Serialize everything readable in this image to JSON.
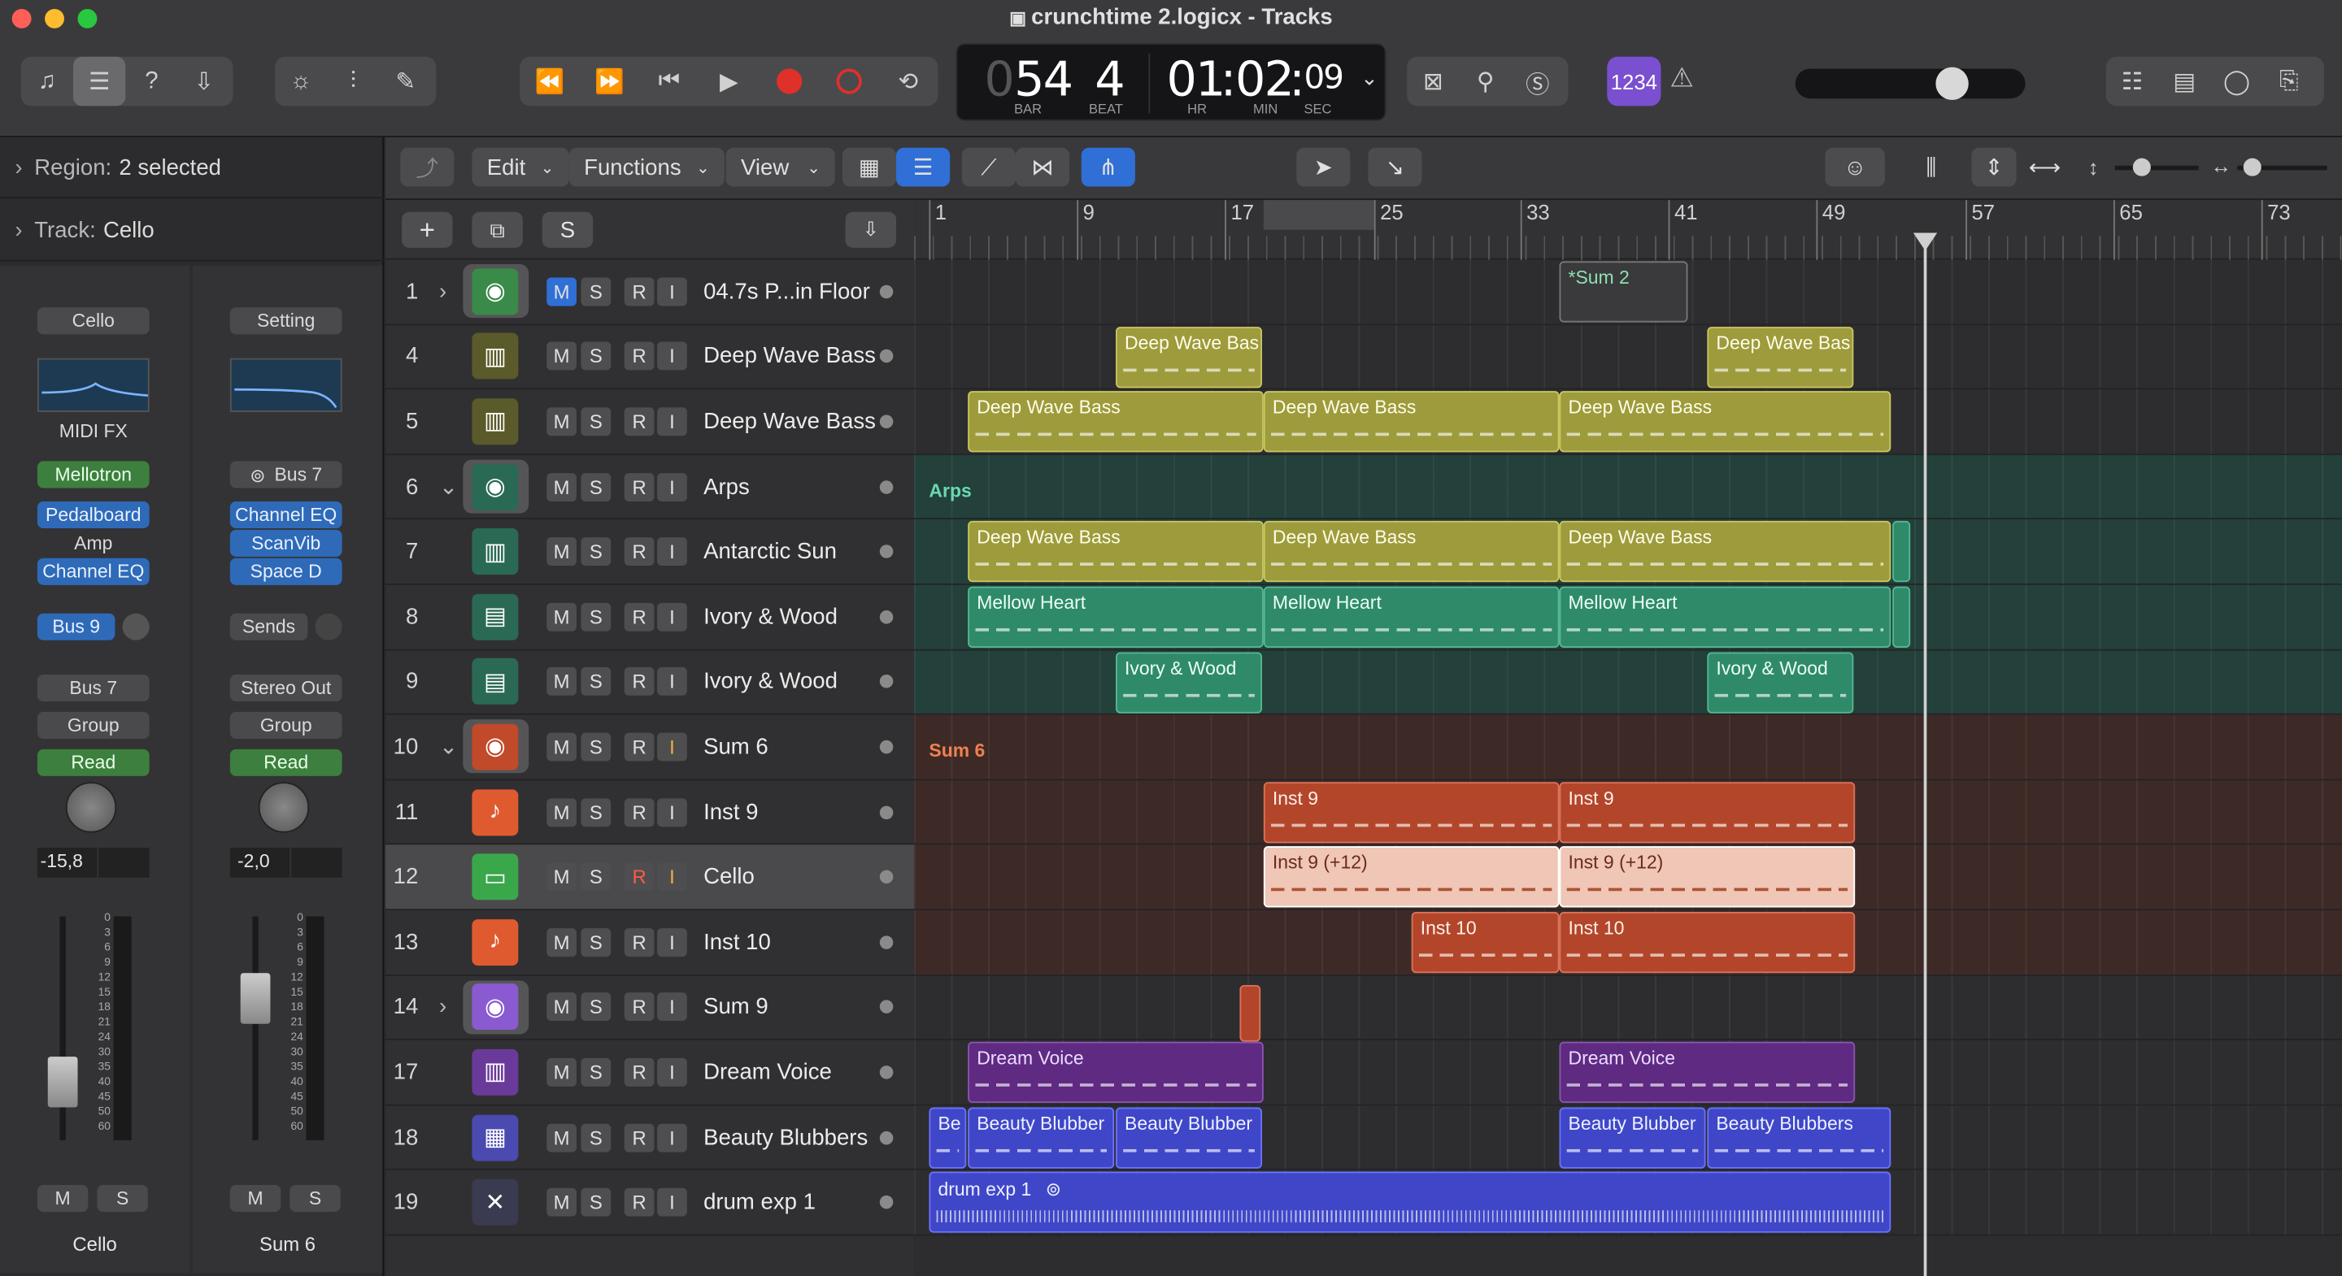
{
  "window": {
    "title": "crunchtime 2.logicx - Tracks"
  },
  "lcd": {
    "bar": "54",
    "beat": "4",
    "time_hr": "01",
    "time_min": "02",
    "time_sec": "09",
    "bar_label": "BAR",
    "beat_label": "BEAT",
    "hr_label": "HR",
    "min_label": "MIN",
    "sec_label": "SEC",
    "prev_digit": "0"
  },
  "toolbar": {
    "count_in": "1234"
  },
  "inspector": {
    "region_label": "Region:",
    "region_value": "2 selected",
    "track_label": "Track:",
    "track_value": "Cello"
  },
  "strip_left": {
    "name": "Cello",
    "midi_fx": "MIDI FX",
    "instrument": "Mellotron",
    "plugins": [
      "Pedalboard",
      "Amp",
      "Channel EQ"
    ],
    "send": "Bus 9",
    "output": "Bus 7",
    "group": "Group",
    "automation": "Read",
    "volume": "-15,8",
    "mute": "M",
    "solo": "S",
    "footer": "Cello"
  },
  "strip_right": {
    "name": "Setting",
    "input": "Bus 7",
    "plugins": [
      "Channel EQ",
      "ScanVib",
      "Space D"
    ],
    "sends": "Sends",
    "output": "Stereo Out",
    "group": "Group",
    "automation": "Read",
    "volume": "-2,0",
    "mute": "M",
    "solo": "S",
    "footer": "Sum 6"
  },
  "fader_scale": [
    "0",
    "3",
    "6",
    "9",
    "12",
    "15",
    "18",
    "21",
    "24",
    "30",
    "35",
    "40",
    "45",
    "50",
    "60"
  ],
  "localbar": {
    "edit": "Edit",
    "functions": "Functions",
    "view": "View",
    "add_label": "+",
    "s_label": "S"
  },
  "ruler": {
    "marks": [
      "1",
      "9",
      "17",
      "25",
      "33",
      "41",
      "49",
      "57",
      "65",
      "73"
    ]
  },
  "tracks": [
    {
      "num": "1",
      "name": "04.7s P...in Floor",
      "m": "M",
      "s": "S",
      "r": "R",
      "i": "I"
    },
    {
      "num": "4",
      "name": "Deep Wave Bass",
      "m": "M",
      "s": "S",
      "r": "R",
      "i": "I"
    },
    {
      "num": "5",
      "name": "Deep Wave Bass",
      "m": "M",
      "s": "S",
      "r": "R",
      "i": "I"
    },
    {
      "num": "6",
      "name": "Arps",
      "m": "M",
      "s": "S",
      "r": "R",
      "i": "I"
    },
    {
      "num": "7",
      "name": "Antarctic Sun",
      "m": "M",
      "s": "S",
      "r": "R",
      "i": "I"
    },
    {
      "num": "8",
      "name": "Ivory & Wood",
      "m": "M",
      "s": "S",
      "r": "R",
      "i": "I"
    },
    {
      "num": "9",
      "name": "Ivory & Wood",
      "m": "M",
      "s": "S",
      "r": "R",
      "i": "I"
    },
    {
      "num": "10",
      "name": "Sum 6",
      "m": "M",
      "s": "S",
      "r": "R",
      "i": "I"
    },
    {
      "num": "11",
      "name": "Inst 9",
      "m": "M",
      "s": "S",
      "r": "R",
      "i": "I"
    },
    {
      "num": "12",
      "name": "Cello",
      "m": "M",
      "s": "S",
      "r": "R",
      "i": "I"
    },
    {
      "num": "13",
      "name": "Inst 10",
      "m": "M",
      "s": "S",
      "r": "R",
      "i": "I"
    },
    {
      "num": "14",
      "name": "Sum 9",
      "m": "M",
      "s": "S",
      "r": "R",
      "i": "I"
    },
    {
      "num": "17",
      "name": "Dream Voice",
      "m": "M",
      "s": "S",
      "r": "R",
      "i": "I"
    },
    {
      "num": "18",
      "name": "Beauty Blubbers",
      "m": "M",
      "s": "S",
      "r": "R",
      "i": "I"
    },
    {
      "num": "19",
      "name": "drum exp 1",
      "m": "M",
      "s": "S",
      "r": "R",
      "i": "I"
    }
  ],
  "groups": {
    "arps": "Arps",
    "sum6": "Sum 6"
  },
  "regions": {
    "sum2": "*Sum 2",
    "dwb": "Deep Wave Bas",
    "dwb_full": "Deep Wave Bass",
    "mellow": "Mellow Heart",
    "ivory": "Ivory & Wood",
    "inst9": "Inst 9",
    "inst9_12": "Inst 9 (+12)",
    "inst10": "Inst 10",
    "dream": "Dream Voice",
    "be": "Be",
    "beauty": "Beauty Blubber",
    "beauty_full": "Beauty Blubbers",
    "drum": "drum exp 1"
  }
}
